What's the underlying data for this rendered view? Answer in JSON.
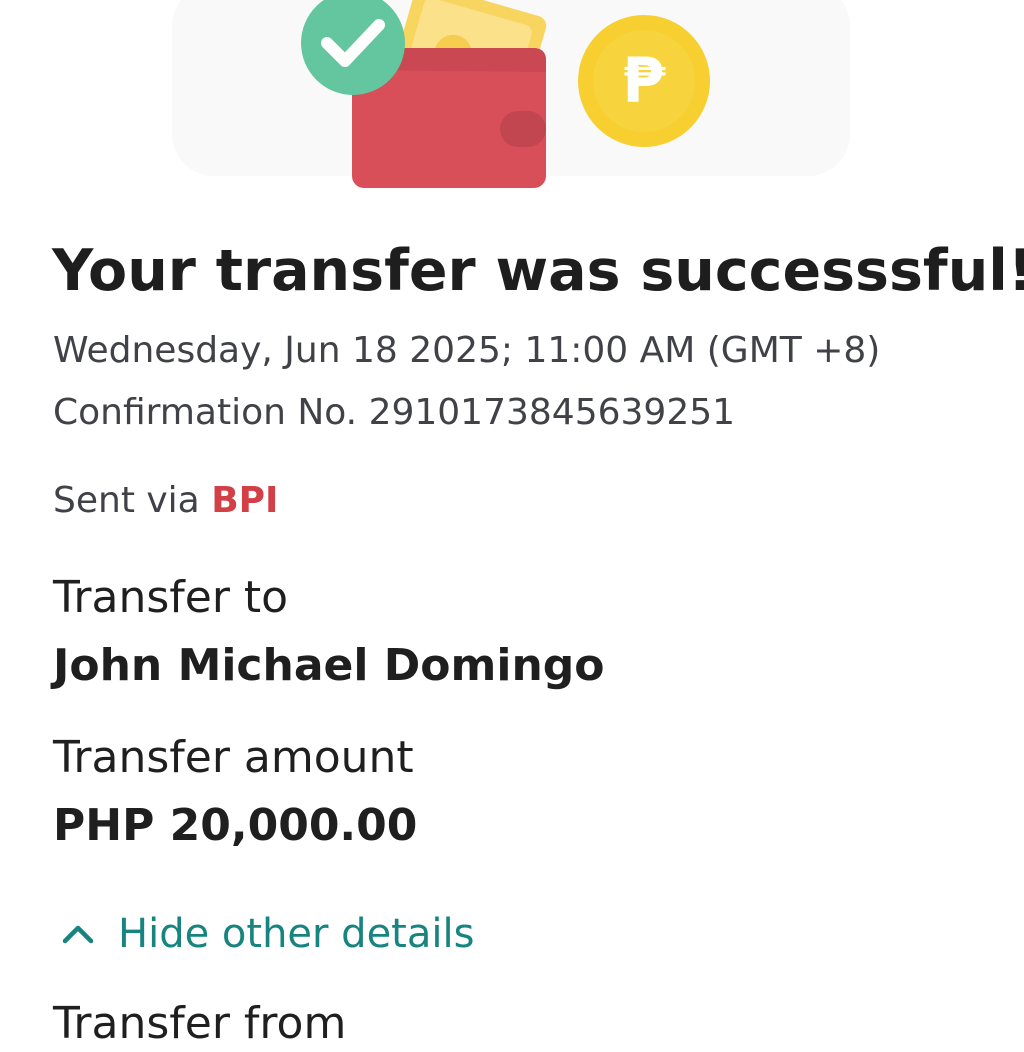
{
  "hero": {
    "icons": [
      "check-circle-icon",
      "wallet-icon",
      "peso-coin-icon"
    ],
    "peso_symbol": "₱",
    "colors": {
      "check_circle": "#63c69e",
      "wallet": "#d84f59",
      "coin": "#f5cf35",
      "bill": "#f9df79"
    }
  },
  "receipt": {
    "title": "Your transfer was successsful!",
    "datetime": "Wednesday, Jun 18 2025; 11:00 AM (GMT +8)",
    "confirmation": "Confirmation No. 2910173845639251",
    "sent_via_label": "Sent via",
    "sent_via_bank": "BPI",
    "transfer_to_label": "Transfer to",
    "recipient_name": "John Michael Domingo",
    "amount_label": "Transfer amount",
    "amount_value": "PHP 20,000.00"
  },
  "details": {
    "toggle_label": "Hide other details",
    "toggle_icon": "chevron-up-icon",
    "transfer_from_label": "Transfer from"
  },
  "colors": {
    "accent_teal": "#17847f",
    "bank_red": "#d23f46",
    "title_text": "#1e1e1e",
    "secondary_text": "#404247"
  }
}
